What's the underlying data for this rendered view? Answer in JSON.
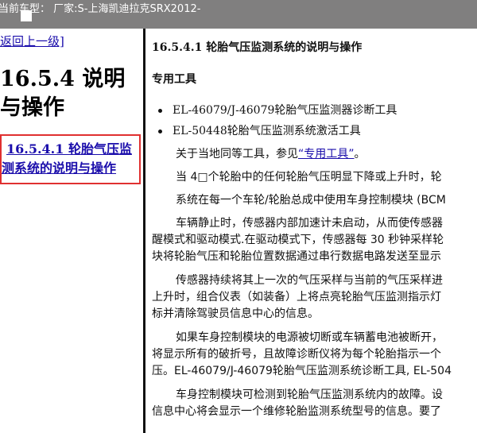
{
  "titlebar": {
    "title": "当前车型： 厂家:S-上海凯迪拉克SRX2012-"
  },
  "left_pane": {
    "back_link": "返回上一级]",
    "heading_line1": "16.5.4 说明",
    "heading_line2": "与操作",
    "toc_line1": "16.5.4.1 轮胎气压监",
    "toc_line2": "测系统的说明与操作"
  },
  "right_pane": {
    "page_title": "16.5.4.1 轮胎气压监测系统的说明与操作",
    "tools_heading": "专用工具",
    "tools": [
      "EL-46079/J-46079轮胎气压监测器诊断工具",
      "EL-50448轮胎气压监测系统激活工具"
    ],
    "p1_before_link": "关于当地同等工具，参见",
    "p1_link": "“专用工具”",
    "p1_after_link": "。",
    "p2": "当 4□个轮胎中的任何轮胎气压明显下降或上升时，轮",
    "p3": "系统在每一个车轮/轮胎总成中使用车身控制模块 (BCM",
    "p4_l1": "车辆静止时，传感器内部加速计未启动，从而使传感器",
    "p4_l2": "醒模式和驱动模式.在驱动模式下，传感器每 30 秒钟采样轮",
    "p4_l3": "块将轮胎气压和轮胎位置数据通过串行数据电路发送至显示",
    "p5_l1": "传感器持续将其上一次的气压采样与当前的气压采样进",
    "p5_l2": "上升时，组合仪表（如装备）上将点亮轮胎气压监测指示灯",
    "p5_l3": "标并清除驾驶员信息中心的信息。",
    "p6_l1": "如果车身控制模块的电源被切断或车辆蓄电池被断开，",
    "p6_l2": "将显示所有的破折号，且故障诊断仪将为每个轮胎指示一个",
    "p6_l3": "压。EL-46079/J-46079轮胎气压监测系统诊断工具, EL-504",
    "p7_l1": "车身控制模块可检测到轮胎气压监测系统内的故障。设",
    "p7_l2": "信息中心将会显示一个维修轮胎监测系统型号的信息。要了"
  }
}
